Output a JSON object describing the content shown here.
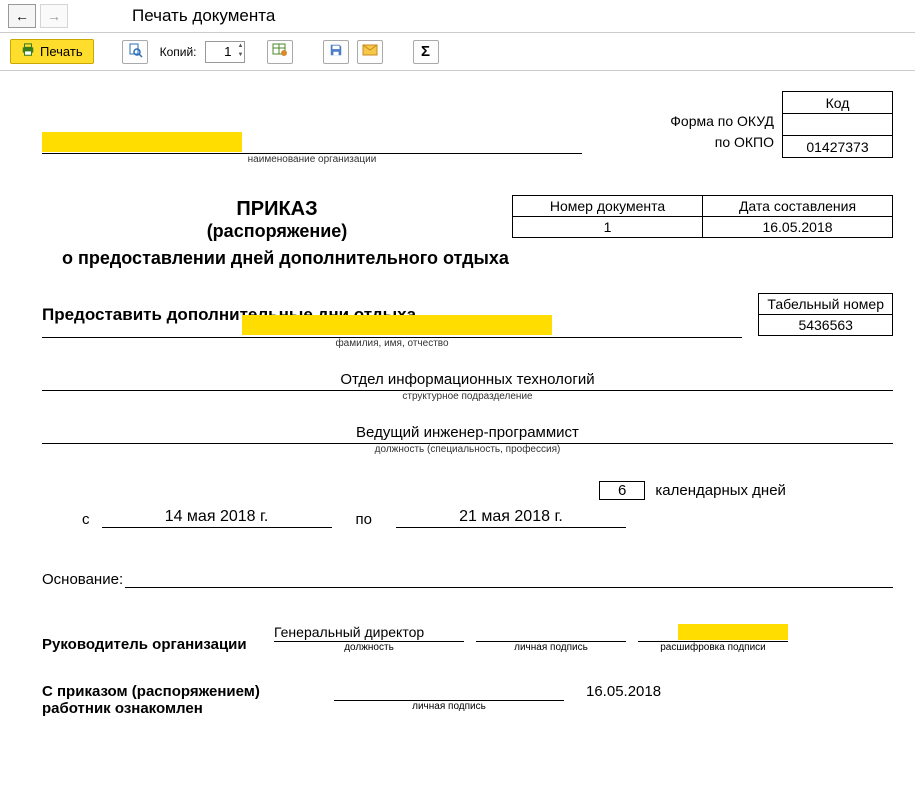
{
  "header": {
    "title": "Печать документа"
  },
  "toolbar": {
    "print_label": "Печать",
    "copies_label": "Копий:",
    "copies_value": "1"
  },
  "form_labels": {
    "okud": "Форма по ОКУД",
    "okpo": "по ОКПО",
    "kod_header": "Код",
    "okud_value": "",
    "okpo_value": "01427373"
  },
  "org_caption": "наименование организации",
  "doc_info": {
    "num_header": "Номер документа",
    "date_header": "Дата составления",
    "num_value": "1",
    "date_value": "16.05.2018"
  },
  "title": {
    "line1": "ПРИКАЗ",
    "line2": "(распоряжение)",
    "line3": "о предоставлении дней дополнительного отдыха"
  },
  "provide": {
    "text": "Предоставить дополнительные дни отдыха",
    "tab_header": "Табельный номер",
    "tab_value": "5436563"
  },
  "fio_caption": "фамилия, имя, отчество",
  "department": {
    "value": "Отдел информационных технологий",
    "caption": "структурное подразделение"
  },
  "position": {
    "value": "Ведущий инженер-программист",
    "caption": "должность (специальность, профессия)"
  },
  "period": {
    "days_value": "6",
    "days_label": "календарных дней",
    "from_label": "с",
    "from_value": "14 мая 2018 г.",
    "to_label": "по",
    "to_value": "21 мая 2018 г."
  },
  "basis_label": "Основание:",
  "manager": {
    "label": "Руководитель организации",
    "position_value": "Генеральный директор",
    "position_caption": "должность",
    "sign_caption": "личная подпись",
    "name_caption": "расшифровка подписи"
  },
  "acknowledge": {
    "label": "С приказом (распоряжением) работник  ознакомлен",
    "sign_caption": "личная подпись",
    "date_value": "16.05.2018"
  }
}
